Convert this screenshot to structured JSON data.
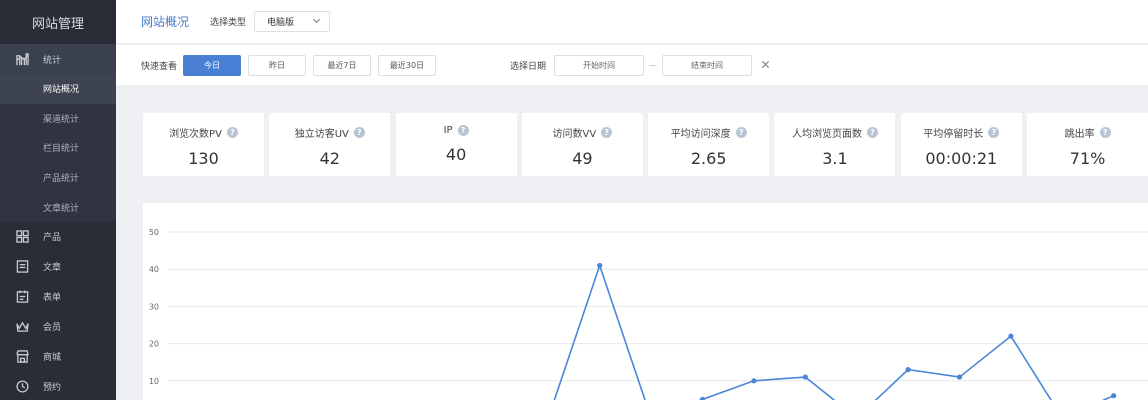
{
  "sidebar": {
    "brand": "网站管理",
    "group": {
      "label": "统计",
      "icon": "chart-icon"
    },
    "sub_items": [
      {
        "label": "网站概况",
        "active": true
      },
      {
        "label": "渠道统计"
      },
      {
        "label": "栏目统计"
      },
      {
        "label": "产品统计"
      },
      {
        "label": "文章统计"
      }
    ],
    "items": [
      {
        "label": "产品",
        "icon": "grid-icon"
      },
      {
        "label": "文章",
        "icon": "document-icon"
      },
      {
        "label": "表单",
        "icon": "clipboard-icon"
      },
      {
        "label": "会员",
        "icon": "crown-icon"
      },
      {
        "label": "商城",
        "icon": "store-icon"
      },
      {
        "label": "预约",
        "icon": "clock-icon"
      }
    ]
  },
  "header": {
    "title": "网站概况",
    "type_label": "选择类型",
    "type_value": "电脑版"
  },
  "filters": {
    "quick_label": "快速查看",
    "quick_buttons": [
      {
        "label": "今日",
        "active": true
      },
      {
        "label": "昨日"
      },
      {
        "label": "最近7日"
      },
      {
        "label": "最近30日"
      }
    ],
    "date_label": "选择日期",
    "start_placeholder": "开始时间",
    "separator": "—",
    "end_placeholder": "结束时间"
  },
  "stats": [
    {
      "label": "浏览次数PV",
      "value": "130"
    },
    {
      "label": "独立访客UV",
      "value": "42"
    },
    {
      "label": "IP",
      "value": "40"
    },
    {
      "label": "访问数VV",
      "value": "49"
    },
    {
      "label": "平均访问深度",
      "value": "2.65"
    },
    {
      "label": "人均浏览页面数",
      "value": "3.1"
    },
    {
      "label": "平均停留时长",
      "value": "00:00:21"
    },
    {
      "label": "跳出率",
      "value": "71%"
    }
  ],
  "chart_data": {
    "type": "line",
    "ylim": [
      0,
      50
    ],
    "y_ticks": [
      "10",
      "20",
      "30",
      "40",
      "50"
    ],
    "color": "#4a86d8",
    "series": [
      {
        "values": [
          0,
          0,
          0,
          0,
          0,
          0,
          0,
          0,
          41,
          0,
          5,
          10,
          11,
          0,
          13,
          11,
          22,
          0,
          6
        ]
      }
    ]
  }
}
